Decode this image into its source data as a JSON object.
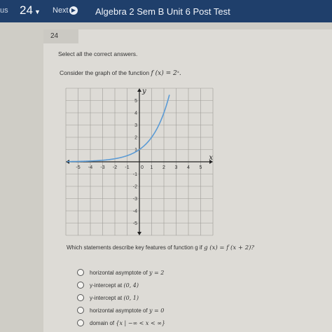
{
  "topbar": {
    "prev_label": "us",
    "question_number": "24",
    "next_label": "Next",
    "title": "Algebra 2 Sem B Unit 6 Post Test"
  },
  "question": {
    "badge": "24",
    "instruction": "Select all the correct answers.",
    "prompt_text": "Consider the graph of the function",
    "prompt_math": "f (x) = 2ˣ.",
    "followup_text": "Which statements describe key features of function g if",
    "followup_math": "g (x) = f (x + 2)?"
  },
  "graph": {
    "x_axis_label": "x",
    "y_axis_label": "y",
    "x_ticks": [
      "-5",
      "-4",
      "-3",
      "-2",
      "-1",
      "0",
      "1",
      "2",
      "3",
      "4",
      "5"
    ],
    "y_ticks": [
      "5",
      "4",
      "3",
      "2",
      "1",
      "-1",
      "-2",
      "-3",
      "-4",
      "-5"
    ],
    "xlim": [
      -6,
      6
    ],
    "ylim": [
      -6,
      6
    ],
    "function": "2^x",
    "curve_color": "#5b9bd5"
  },
  "options": [
    {
      "text": "horizontal asymptote of",
      "math": "y = 2"
    },
    {
      "text": "y-intercept at",
      "math": "(0, 4)"
    },
    {
      "text": "y-intercept at",
      "math": "(0, 1)"
    },
    {
      "text": "horizontal asymptote of",
      "math": "y = 0"
    },
    {
      "text": "domain of",
      "math": "{x | −∞ < x < ∞}"
    }
  ]
}
